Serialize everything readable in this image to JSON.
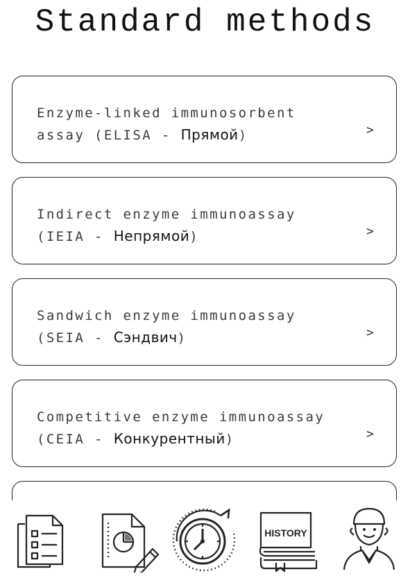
{
  "page": {
    "title": "Standard methods"
  },
  "methods": [
    {
      "line1": "Enzyme-linked immunosorbent",
      "line2_prefix": "assay (ELISA - ",
      "line2_ru": "Прямой",
      "line2_suffix": ")",
      "chevron": ">"
    },
    {
      "line1": "Indirect enzyme immunoassay",
      "line2_prefix": "(IEIA - ",
      "line2_ru": "Непрямой",
      "line2_suffix": ")",
      "chevron": ">"
    },
    {
      "line1": "Sandwich enzyme immunoassay",
      "line2_prefix": "(SEIA - ",
      "line2_ru": "Сэндвич",
      "line2_suffix": ")",
      "chevron": ">"
    },
    {
      "line1": "Competitive enzyme immunoassay",
      "line2_prefix": "(CEIA - ",
      "line2_ru": "Конкурентный",
      "line2_suffix": ")",
      "chevron": ">"
    }
  ],
  "bottom_nav": [
    {
      "icon": "checklist-icon"
    },
    {
      "icon": "report-edit-icon"
    },
    {
      "icon": "timer-refresh-icon"
    },
    {
      "icon": "history-book-icon",
      "label": "HISTORY"
    },
    {
      "icon": "doctor-icon"
    }
  ]
}
